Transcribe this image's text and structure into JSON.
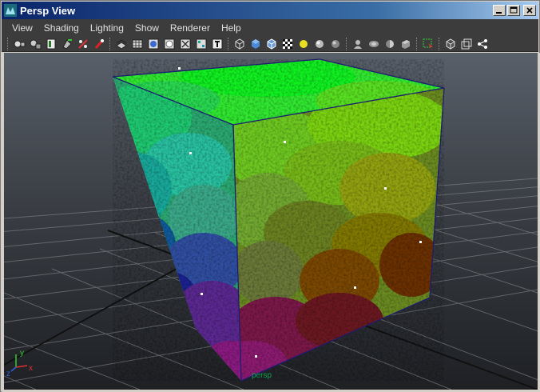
{
  "window": {
    "title": "Persp View"
  },
  "menu": [
    "View",
    "Shading",
    "Lighting",
    "Show",
    "Renderer",
    "Help"
  ],
  "toolbar_icons": [
    "select-camera-icon",
    "lock-camera-icon",
    "camera-attribute-icon",
    "bookmark-icon",
    "image-plane-icon",
    "gate-mask-icon",
    "grid-icon",
    "film-gate-icon",
    "resolution-gate-icon",
    "safe-action-icon",
    "field-chart-icon",
    "safe-title-icon",
    "wireframe-icon",
    "smooth-shade-icon",
    "wireframe-on-shaded-icon",
    "textured-icon",
    "use-lights-icon",
    "shadows-icon",
    "sphere-icon",
    "xray-icon",
    "xray-joints-icon",
    "xray-components-icon",
    "backface-icon",
    "isolate-select-icon",
    "bounding-box-icon",
    "render-node-icon",
    "graph-icon"
  ],
  "viewport": {
    "camera_label": "persp",
    "axis": {
      "x": "x",
      "y": "y",
      "z": "z"
    },
    "colors": {
      "x_axis": "#e03030",
      "y_axis": "#30d030",
      "z_axis": "#3060e0"
    }
  }
}
